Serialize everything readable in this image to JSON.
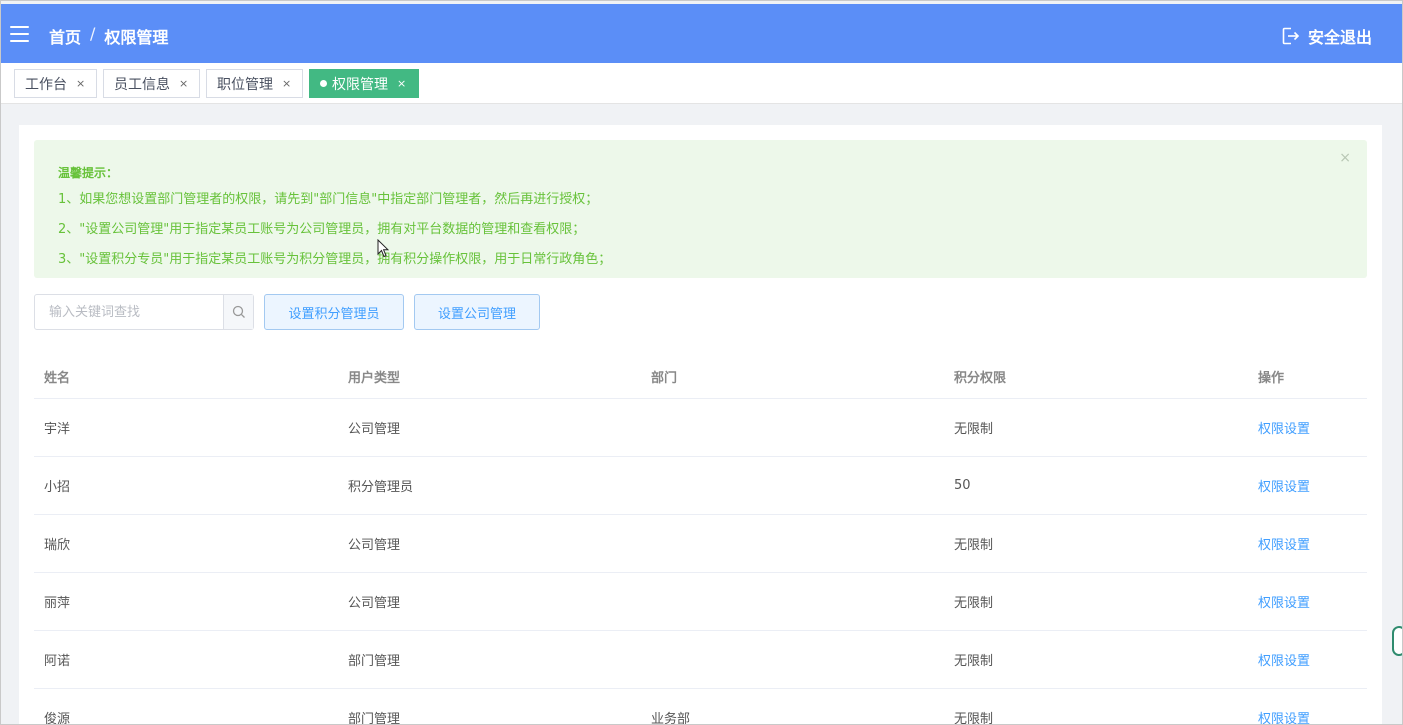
{
  "header": {
    "breadcrumb": [
      "首页",
      "/",
      "权限管理"
    ],
    "logout_label": "安全退出",
    "bg_color": "#5b8ef7"
  },
  "tabs": [
    {
      "label": "工作台",
      "active": false
    },
    {
      "label": "员工信息",
      "active": false
    },
    {
      "label": "职位管理",
      "active": false
    },
    {
      "label": "权限管理",
      "active": true
    }
  ],
  "tab_close": "×",
  "alert": {
    "title": "温馨提示：",
    "close": "×",
    "lines": [
      "1、如果您想设置部门管理者的权限，请先到\"部门信息\"中指定部门管理者，然后再进行授权；",
      "2、\"设置公司管理\"用于指定某员工账号为公司管理员，拥有对平台数据的管理和查看权限；",
      "3、\"设置积分专员\"用于指定某员工账号为积分管理员，拥有积分操作权限，用于日常行政角色；"
    ]
  },
  "search": {
    "placeholder": "输入关键词查找",
    "value": "",
    "icon": "search-icon"
  },
  "buttons": {
    "set_points_admin": "设置积分管理员",
    "set_company_admin": "设置公司管理"
  },
  "table": {
    "columns": [
      "姓名",
      "用户类型",
      "部门",
      "积分权限",
      "操作"
    ],
    "rows": [
      {
        "name": "宇洋",
        "type": "公司管理",
        "dept": "",
        "points": "无限制",
        "action": "权限设置"
      },
      {
        "name": "小招",
        "type": "积分管理员",
        "dept": "",
        "points": "50",
        "action": "权限设置"
      },
      {
        "name": "瑞欣",
        "type": "公司管理",
        "dept": "",
        "points": "无限制",
        "action": "权限设置"
      },
      {
        "name": "丽萍",
        "type": "公司管理",
        "dept": "",
        "points": "无限制",
        "action": "权限设置"
      },
      {
        "name": "阿诺",
        "type": "部门管理",
        "dept": "",
        "points": "无限制",
        "action": "权限设置"
      },
      {
        "name": "俊源",
        "type": "部门管理",
        "dept": "业务部",
        "points": "无限制",
        "action": "权限设置"
      }
    ]
  },
  "colors": {
    "accent": "#409eff",
    "active_tab": "#42b983",
    "alert_text": "#67c23a",
    "alert_bg": "#edf8ea"
  }
}
